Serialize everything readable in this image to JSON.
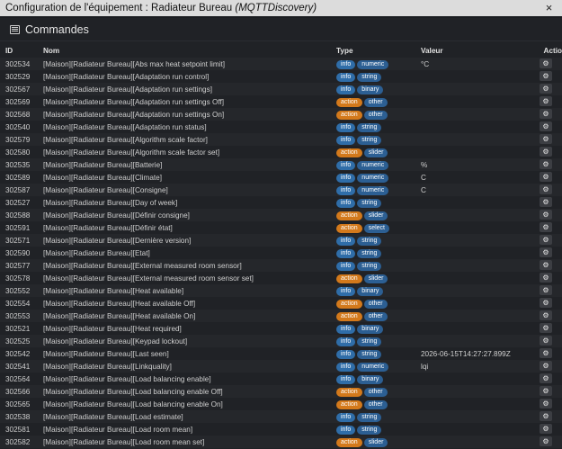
{
  "window": {
    "title_prefix": "Configuration de l'équipement : Radiateur Bureau ",
    "title_italic": "(MQTTDiscovery)",
    "close_glyph": "×"
  },
  "panel": {
    "title": "Commandes"
  },
  "table": {
    "headers": {
      "id": "ID",
      "nom": "Nom",
      "type": "Type",
      "valeur": "Valeur",
      "actions": "Actio"
    },
    "rows": [
      {
        "id": "302534",
        "nom": "[Maison][Radiateur Bureau][Abs max heat setpoint limit]",
        "type": "info",
        "subtype": "numeric",
        "valeur": "°C"
      },
      {
        "id": "302529",
        "nom": "[Maison][Radiateur Bureau][Adaptation run control]",
        "type": "info",
        "subtype": "string",
        "valeur": ""
      },
      {
        "id": "302567",
        "nom": "[Maison][Radiateur Bureau][Adaptation run settings]",
        "type": "info",
        "subtype": "binary",
        "valeur": ""
      },
      {
        "id": "302569",
        "nom": "[Maison][Radiateur Bureau][Adaptation run settings Off]",
        "type": "action",
        "subtype": "other",
        "valeur": ""
      },
      {
        "id": "302568",
        "nom": "[Maison][Radiateur Bureau][Adaptation run settings On]",
        "type": "action",
        "subtype": "other",
        "valeur": ""
      },
      {
        "id": "302540",
        "nom": "[Maison][Radiateur Bureau][Adaptation run status]",
        "type": "info",
        "subtype": "string",
        "valeur": ""
      },
      {
        "id": "302579",
        "nom": "[Maison][Radiateur Bureau][Algorithm scale factor]",
        "type": "info",
        "subtype": "string",
        "valeur": ""
      },
      {
        "id": "302580",
        "nom": "[Maison][Radiateur Bureau][Algorithm scale factor set]",
        "type": "action",
        "subtype": "slider",
        "valeur": ""
      },
      {
        "id": "302535",
        "nom": "[Maison][Radiateur Bureau][Batterie]",
        "type": "info",
        "subtype": "numeric",
        "valeur": "%"
      },
      {
        "id": "302589",
        "nom": "[Maison][Radiateur Bureau][Climate]",
        "type": "info",
        "subtype": "numeric",
        "valeur": "C"
      },
      {
        "id": "302587",
        "nom": "[Maison][Radiateur Bureau][Consigne]",
        "type": "info",
        "subtype": "numeric",
        "valeur": "C"
      },
      {
        "id": "302527",
        "nom": "[Maison][Radiateur Bureau][Day of week]",
        "type": "info",
        "subtype": "string",
        "valeur": ""
      },
      {
        "id": "302588",
        "nom": "[Maison][Radiateur Bureau][Définir consigne]",
        "type": "action",
        "subtype": "slider",
        "valeur": ""
      },
      {
        "id": "302591",
        "nom": "[Maison][Radiateur Bureau][Définir état]",
        "type": "action",
        "subtype": "select",
        "valeur": ""
      },
      {
        "id": "302571",
        "nom": "[Maison][Radiateur Bureau][Dernière version]",
        "type": "info",
        "subtype": "string",
        "valeur": ""
      },
      {
        "id": "302590",
        "nom": "[Maison][Radiateur Bureau][Etat]",
        "type": "info",
        "subtype": "string",
        "valeur": ""
      },
      {
        "id": "302577",
        "nom": "[Maison][Radiateur Bureau][External measured room sensor]",
        "type": "info",
        "subtype": "string",
        "valeur": ""
      },
      {
        "id": "302578",
        "nom": "[Maison][Radiateur Bureau][External measured room sensor set]",
        "type": "action",
        "subtype": "slider",
        "valeur": ""
      },
      {
        "id": "302552",
        "nom": "[Maison][Radiateur Bureau][Heat available]",
        "type": "info",
        "subtype": "binary",
        "valeur": ""
      },
      {
        "id": "302554",
        "nom": "[Maison][Radiateur Bureau][Heat available Off]",
        "type": "action",
        "subtype": "other",
        "valeur": ""
      },
      {
        "id": "302553",
        "nom": "[Maison][Radiateur Bureau][Heat available On]",
        "type": "action",
        "subtype": "other",
        "valeur": ""
      },
      {
        "id": "302521",
        "nom": "[Maison][Radiateur Bureau][Heat required]",
        "type": "info",
        "subtype": "binary",
        "valeur": ""
      },
      {
        "id": "302525",
        "nom": "[Maison][Radiateur Bureau][Keypad lockout]",
        "type": "info",
        "subtype": "string",
        "valeur": ""
      },
      {
        "id": "302542",
        "nom": "[Maison][Radiateur Bureau][Last seen]",
        "type": "info",
        "subtype": "string",
        "valeur": "2026-06-15T14:27:27.899Z"
      },
      {
        "id": "302541",
        "nom": "[Maison][Radiateur Bureau][Linkquality]",
        "type": "info",
        "subtype": "numeric",
        "valeur": "lqi"
      },
      {
        "id": "302564",
        "nom": "[Maison][Radiateur Bureau][Load balancing enable]",
        "type": "info",
        "subtype": "binary",
        "valeur": ""
      },
      {
        "id": "302566",
        "nom": "[Maison][Radiateur Bureau][Load balancing enable Off]",
        "type": "action",
        "subtype": "other",
        "valeur": ""
      },
      {
        "id": "302565",
        "nom": "[Maison][Radiateur Bureau][Load balancing enable On]",
        "type": "action",
        "subtype": "other",
        "valeur": ""
      },
      {
        "id": "302538",
        "nom": "[Maison][Radiateur Bureau][Load estimate]",
        "type": "info",
        "subtype": "string",
        "valeur": ""
      },
      {
        "id": "302581",
        "nom": "[Maison][Radiateur Bureau][Load room mean]",
        "type": "info",
        "subtype": "string",
        "valeur": ""
      },
      {
        "id": "302582",
        "nom": "[Maison][Radiateur Bureau][Load room mean set]",
        "type": "action",
        "subtype": "slider",
        "valeur": ""
      }
    ]
  },
  "icons": {
    "panel": "list-icon",
    "row_action": "gears-icon",
    "close": "close-icon"
  },
  "colors": {
    "info": "#2f6da8",
    "action": "#d3791b",
    "subtype": "#2c5f93",
    "titlebar": "#dcdcdc",
    "background": "#1b1d21"
  }
}
